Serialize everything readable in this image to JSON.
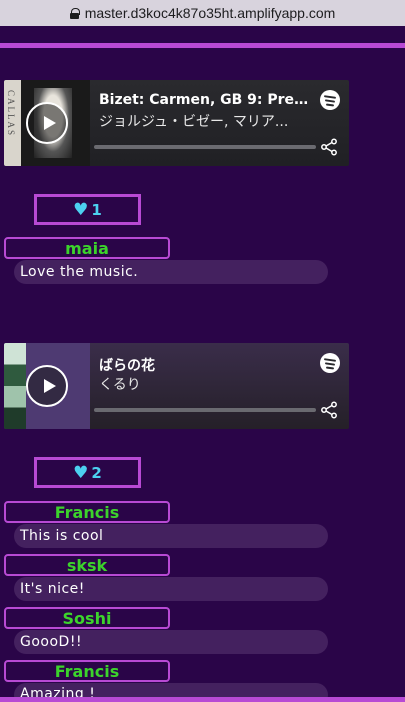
{
  "browser": {
    "url": "master.d3koc4k87o35ht.amplifyapp.com"
  },
  "colors": {
    "background": "#2a0548",
    "accent": "#b84ad4",
    "username": "#3cd32c",
    "like": "#4cd0f0"
  },
  "posts": [
    {
      "track": {
        "title": "Bizet: Carmen, GB 9: Prelu...",
        "artist": "ジョルジュ・ビゼー, マリア...",
        "cover_text": "CALLAS"
      },
      "likes": "1",
      "comments": [
        {
          "user": "maia",
          "text": "Love the music."
        }
      ]
    },
    {
      "track": {
        "title": "ばらの花",
        "artist": "くるり"
      },
      "likes": "2",
      "comments": [
        {
          "user": "Francis",
          "text": "This is cool"
        },
        {
          "user": "sksk",
          "text": "It's nice!"
        },
        {
          "user": "Soshi",
          "text": "GoooD!!"
        },
        {
          "user": "Francis",
          "text": "Amazing !"
        }
      ]
    }
  ],
  "icons": {
    "lock": "lock-icon",
    "play": "play-icon",
    "spotify": "spotify-icon",
    "share": "share-icon",
    "heart": "heart-icon"
  }
}
